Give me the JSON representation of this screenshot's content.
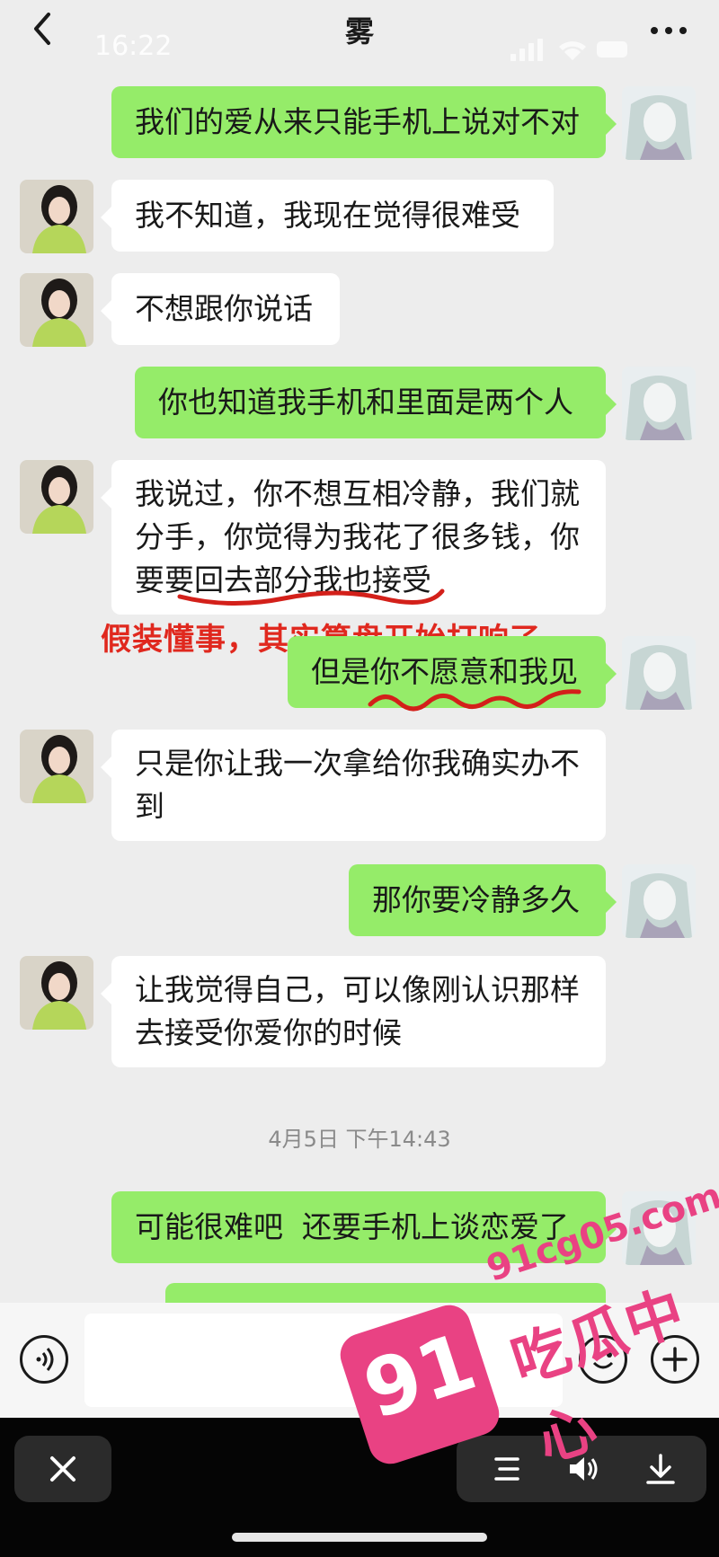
{
  "header": {
    "title": "雾",
    "time": "16:22"
  },
  "messages": [
    {
      "side": "me",
      "text": "我们的爱从来只能手机上说对不对"
    },
    {
      "side": "her",
      "text": "我不知道，我现在觉得很难受"
    },
    {
      "side": "her",
      "text": "不想跟你说话"
    },
    {
      "side": "me",
      "text": "你也知道我手机和里面是两个人"
    },
    {
      "side": "her",
      "text": "我说过，你不想互相冷静，我们就\n分手，你觉得为我花了很多钱，你\n要要回去部分我也接受"
    },
    {
      "side": "me",
      "text": "但是你不愿意和我见"
    },
    {
      "side": "her",
      "text": "只是你让我一次拿给你我确实办不\n到"
    },
    {
      "side": "me",
      "text": "那你要冷静多久"
    },
    {
      "side": "her",
      "text": "让我觉得自己，可以像刚认识那样\n去接受你爱你的时候"
    },
    {
      "side": "me",
      "text": "可能很难吧  还要手机上谈恋爱了"
    }
  ],
  "datestamp": "4月5日 下午14:43",
  "annotation": "假装懂事，其实算盘开始打响了",
  "watermark": {
    "badge": "91",
    "domain": "91cg05.com",
    "name": "吃瓜中心",
    "color": "#e94283"
  },
  "icons": {
    "back": "back-chevron-icon",
    "more": "more-dots-icon",
    "voice": "voice-input-icon",
    "emoji": "emoji-icon",
    "add": "add-icon",
    "close": "close-icon",
    "menu": "menu-lines-icon",
    "volume": "volume-icon",
    "download": "download-icon"
  },
  "colors": {
    "my_bubble": "#95ec69",
    "her_bubble": "#ffffff",
    "annotation": "#e0281e"
  }
}
